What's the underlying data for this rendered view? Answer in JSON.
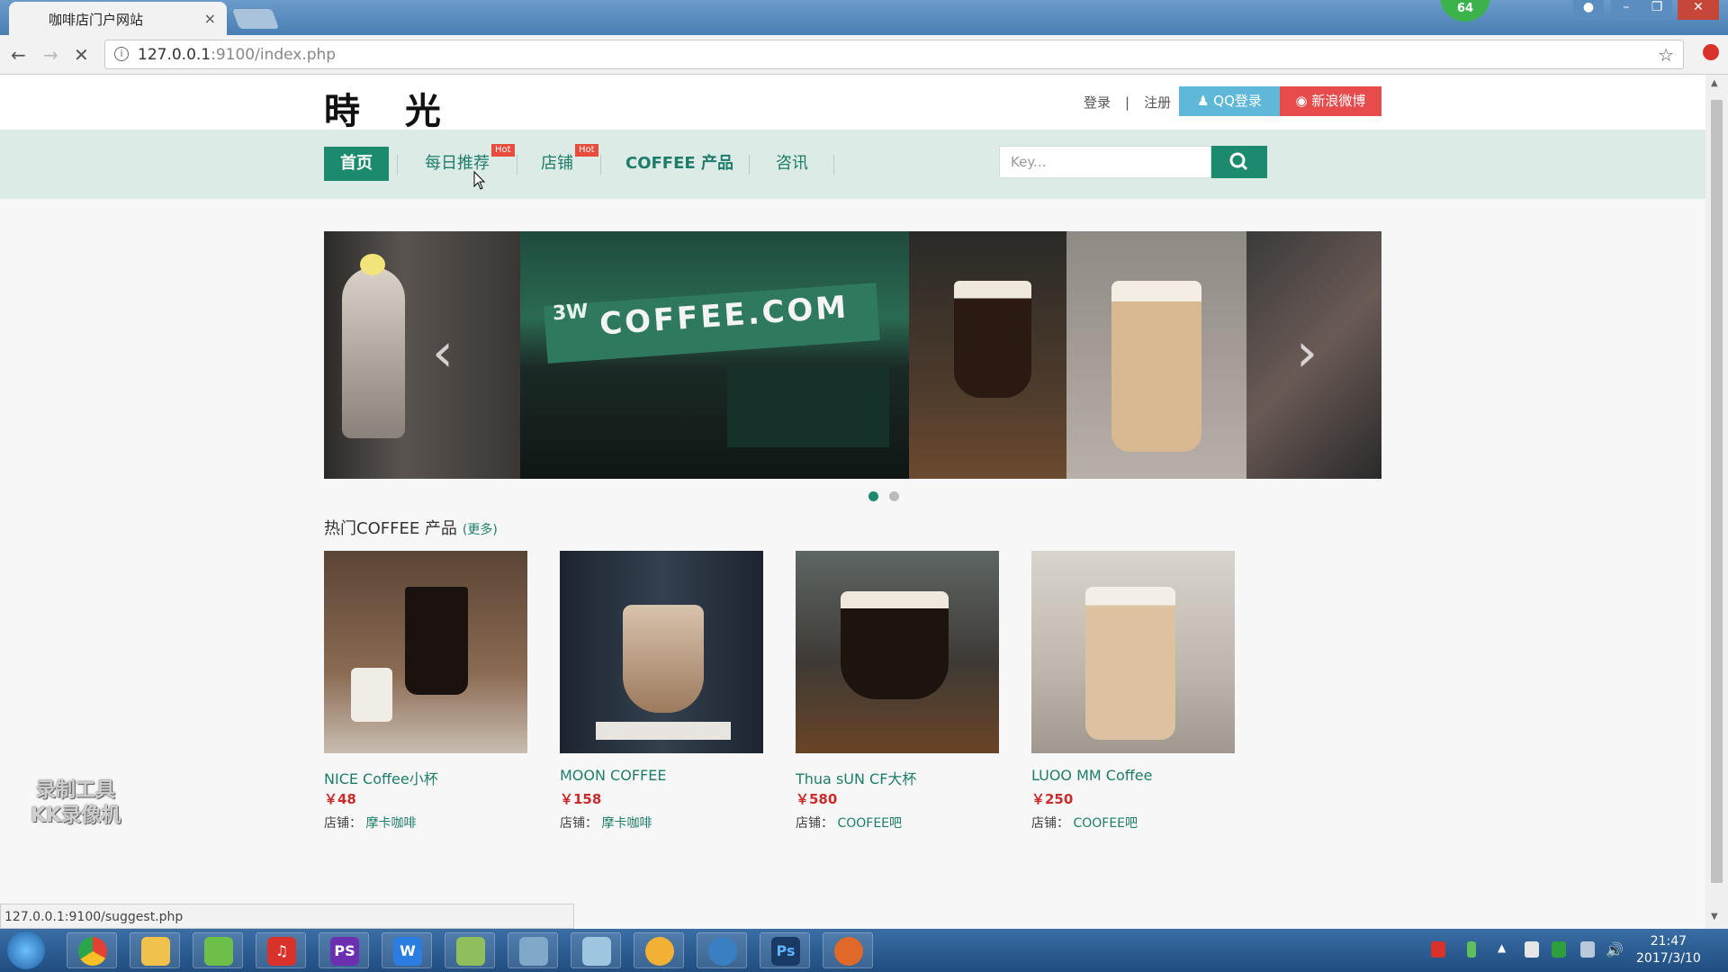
{
  "browser": {
    "tab_title": "咖啡店门户网站",
    "tab_close": "×",
    "profile_badge": "64",
    "url_host": "127.0.0.1",
    "url_path": ":9100/index.php",
    "status_url": "127.0.0.1:9100/suggest.php"
  },
  "header": {
    "logo": "時 光",
    "login": "登录",
    "separator": "|",
    "register": "注册",
    "qq_login": "QQ登录",
    "weibo": "新浪微博"
  },
  "nav": {
    "items": [
      "首页",
      "每日推荐",
      "店铺",
      "COFFEE 产品",
      "咨讯"
    ],
    "hot": "Hot",
    "search_placeholder": "Key..."
  },
  "banner": {
    "signage_text": "COFFEE.COM",
    "brand_text": "3W"
  },
  "section": {
    "title": "热门COFFEE 产品",
    "more": "(更多)"
  },
  "products": [
    {
      "name": "NICE Coffee小杯",
      "price": "￥48",
      "shop_label": "店铺：",
      "shop": "摩卡咖啡"
    },
    {
      "name": "MOON COFFEE",
      "price": "￥158",
      "shop_label": "店铺：",
      "shop": "摩卡咖啡"
    },
    {
      "name": "Thua sUN CF大杯",
      "price": "￥580",
      "shop_label": "店铺：",
      "shop": "COOFEE吧"
    },
    {
      "name": "LUOO MM Coffee",
      "price": "￥250",
      "shop_label": "店铺：",
      "shop": "COOFEE吧"
    }
  ],
  "watermark": [
    "录制工具",
    "KK录像机"
  ],
  "taskbar": {
    "time": "21:47",
    "date": "2017/3/10",
    "apps": [
      "chrome",
      "explorer",
      "feed",
      "netease",
      "PS",
      "W",
      "notepad",
      "remote",
      "files",
      "paint",
      "network",
      "Ps",
      "face"
    ]
  },
  "colors": {
    "accent": "#1c8b6d",
    "nav_bg": "#dcebe6",
    "price": "#cc2b2b",
    "hot": "#e74c3c"
  }
}
